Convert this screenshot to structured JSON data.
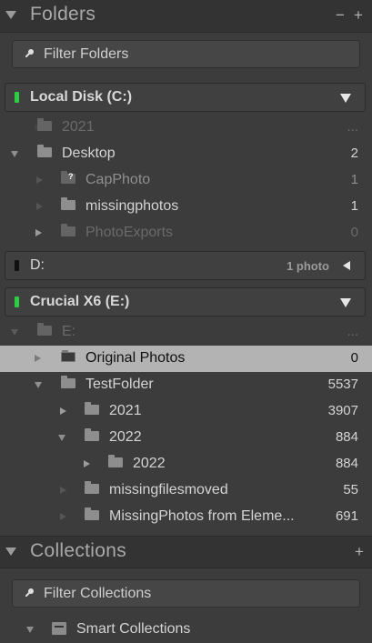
{
  "folders_panel": {
    "title": "Folders",
    "minus_button": "−",
    "plus_button": "+",
    "filter_placeholder": "Filter Folders"
  },
  "volumes": [
    {
      "name": "Local Disk (C:)",
      "led_color": "#2ecc40",
      "count": "",
      "expanded": true
    },
    {
      "name": "D:",
      "led_color": "#111111",
      "count": "1 photo",
      "expanded": false
    },
    {
      "name": "Crucial X6 (E:)",
      "led_color": "#2ecc40",
      "count": "",
      "expanded": true
    }
  ],
  "local_disk_rows": [
    {
      "name": "2021",
      "count": "...",
      "dim": true
    },
    {
      "name": "Desktop",
      "count": "2",
      "dim": false
    },
    {
      "name": "CapPhoto",
      "count": "1",
      "dim": false,
      "missing": true
    },
    {
      "name": "missingphotos",
      "count": "1",
      "dim": false
    },
    {
      "name": "PhotoExports",
      "count": "0",
      "dim": true
    }
  ],
  "crucial_rows": [
    {
      "name": "E:",
      "count": "...",
      "dim": true
    },
    {
      "name": "Original Photos",
      "count": "0",
      "selected": true
    },
    {
      "name": "TestFolder",
      "count": "5537"
    },
    {
      "name": "2021",
      "count": "3907"
    },
    {
      "name": "2022",
      "count": "884"
    },
    {
      "name": "2022",
      "count": "884"
    },
    {
      "name": "missingfilesmoved",
      "count": "55"
    },
    {
      "name": "MissingPhotos from Eleme...",
      "count": "691"
    }
  ],
  "collections_panel": {
    "title": "Collections",
    "plus_button": "+",
    "filter_placeholder": "Filter Collections",
    "first_item": "Smart Collections"
  }
}
